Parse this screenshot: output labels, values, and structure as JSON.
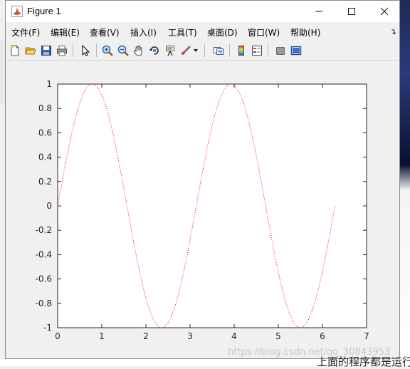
{
  "window": {
    "title": "Figure 1",
    "minimize_glyph": "—",
    "maximize_glyph": "☐",
    "close_glyph": "✕"
  },
  "menu": {
    "items": [
      {
        "label": "文件(F)"
      },
      {
        "label": "编辑(E)"
      },
      {
        "label": "查看(V)"
      },
      {
        "label": "插入(I)"
      },
      {
        "label": "工具(T)"
      },
      {
        "label": "桌面(D)"
      },
      {
        "label": "窗口(W)"
      },
      {
        "label": "帮助(H)"
      }
    ],
    "overflow_glyph": "↴"
  },
  "toolbar": {
    "icons": [
      "new-figure-icon",
      "open-file-icon",
      "save-icon",
      "print-icon",
      "select-arrow-icon",
      "zoom-in-icon",
      "zoom-out-icon",
      "pan-hand-icon",
      "rotate-3d-icon",
      "data-cursor-icon",
      "brush-icon",
      "brush-dropdown-icon",
      "link-plot-icon",
      "colorbar-icon",
      "legend-icon",
      "hide-plot-tools-icon",
      "show-plot-tools-icon"
    ]
  },
  "chart_data": {
    "type": "line",
    "title": "",
    "xlabel": "",
    "ylabel": "",
    "xlim": [
      0,
      7
    ],
    "ylim": [
      -1,
      1
    ],
    "xticks": [
      "0",
      "1",
      "2",
      "3",
      "4",
      "5",
      "6",
      "7"
    ],
    "yticks": [
      "-1",
      "-0.8",
      "-0.6",
      "-0.4",
      "-0.2",
      "0",
      "0.2",
      "0.4",
      "0.6",
      "0.8",
      "1"
    ],
    "series": [
      {
        "line_style": "dotted",
        "color": "#ff0000",
        "function": "sin(2x)",
        "x_range": [
          0,
          6.28
        ]
      }
    ],
    "grid": false,
    "legend": "none"
  },
  "background": {
    "watermark": "https://blog.csdn.net/qq_30843953",
    "partial_text": "上面的程序都是运行"
  }
}
